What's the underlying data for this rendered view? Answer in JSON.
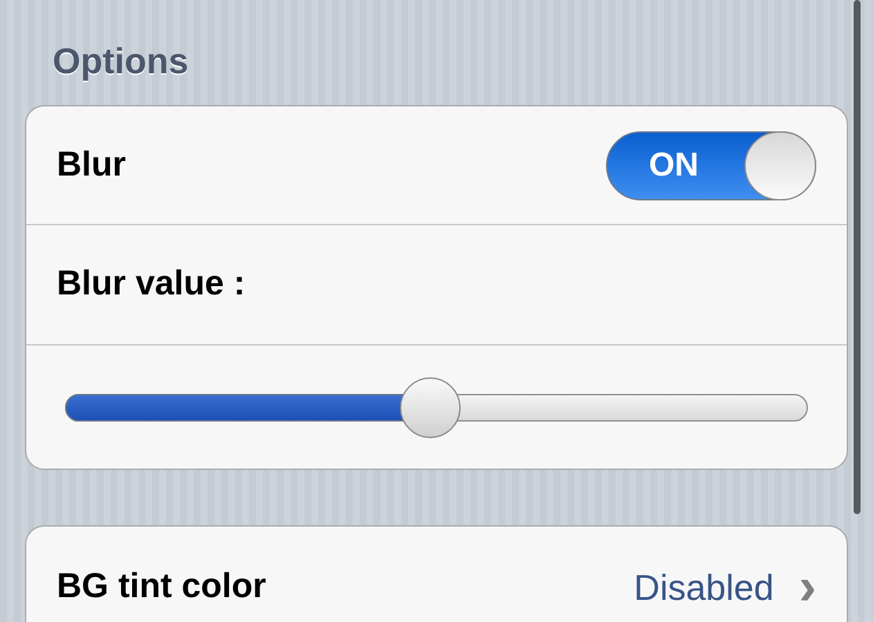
{
  "section_header": "Options",
  "options": [
    {
      "kind": "switch",
      "label": "Blur",
      "on": true,
      "switch_text": "ON"
    },
    {
      "kind": "label",
      "label": "Blur value :"
    },
    {
      "kind": "slider",
      "level": 0.49
    }
  ],
  "settings": [
    {
      "kind": "link",
      "label": "BG tint color",
      "value": "Disabled",
      "chevron": "›"
    }
  ]
}
